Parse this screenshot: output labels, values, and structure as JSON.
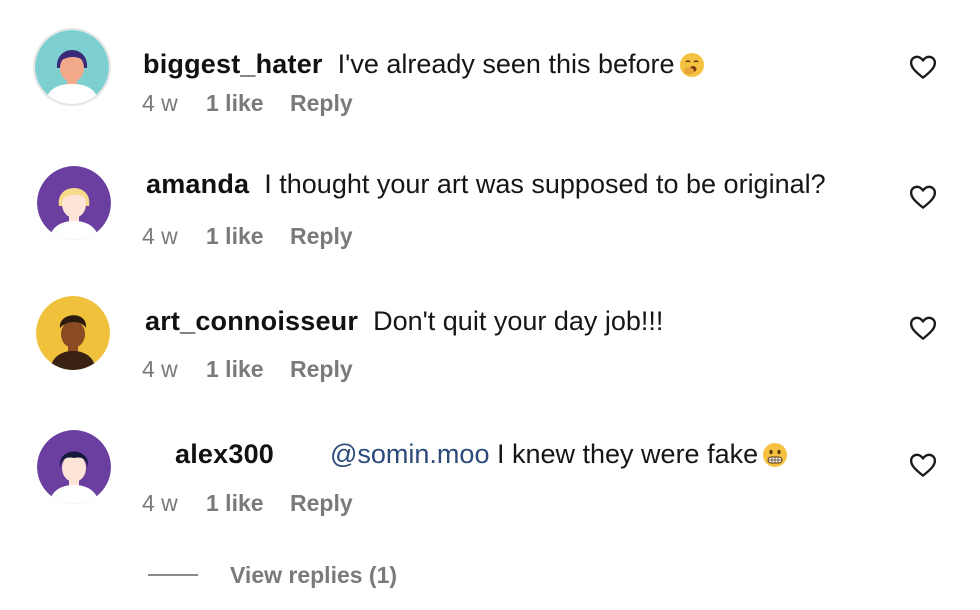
{
  "comments": [
    {
      "username": "biggest_hater",
      "message": "I've already seen this before",
      "emoji": "yawning-face-emoji",
      "age": "4 w",
      "likes": "1 like",
      "reply": "Reply",
      "avatar_bg": "#7ecfcf"
    },
    {
      "username": "amanda",
      "message": "I thought your art was supposed to be original?",
      "age": "4 w",
      "likes": "1 like",
      "reply": "Reply",
      "avatar_bg": "#6b3fa0"
    },
    {
      "username": "art_connoisseur",
      "message": "Don't quit your day job!!!",
      "age": "4 w",
      "likes": "1 like",
      "reply": "Reply",
      "avatar_bg": "#f0c23c"
    },
    {
      "username": "alex300",
      "mention": "@somin.moo",
      "message": "I knew they were fake",
      "emoji": "grimacing-face-emoji",
      "age": "4 w",
      "likes": "1 like",
      "reply": "Reply",
      "avatar_bg": "#6b3fa0"
    }
  ],
  "view_replies": "View replies (1)",
  "colors": {
    "meta_gray": "#7a7a7a",
    "mention_blue": "#2b4a7a",
    "emoji_yellow": "#f5c242"
  }
}
